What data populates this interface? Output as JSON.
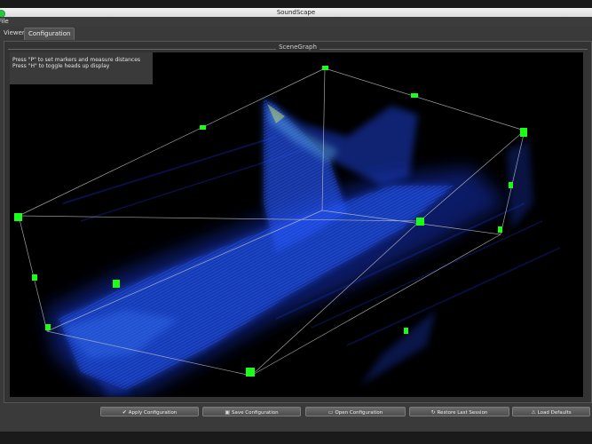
{
  "window": {
    "title": "SoundScape"
  },
  "menu": {
    "file": "File"
  },
  "tabs": [
    {
      "label": "Viewer"
    },
    {
      "label": "Configuration"
    }
  ],
  "scene": {
    "group_title": "SceneGraph",
    "hud_lines": [
      "Press \"P\" to set markers and measure distances",
      "Press \"H\" to toggle heads up display"
    ]
  },
  "buttons": [
    {
      "label": "Apply Configuration",
      "icon": "checkmark-icon"
    },
    {
      "label": "Save Configuration",
      "icon": "floppy-disk-icon"
    },
    {
      "label": "Open Configuration",
      "icon": "folder-open-icon"
    },
    {
      "label": "Restore Last Session",
      "icon": "refresh-icon"
    },
    {
      "label": "Load Defaults",
      "icon": "warning-icon"
    }
  ],
  "colors": {
    "marker": "#19ff19",
    "data_blue": "#1e46d2",
    "background": "#000000"
  }
}
